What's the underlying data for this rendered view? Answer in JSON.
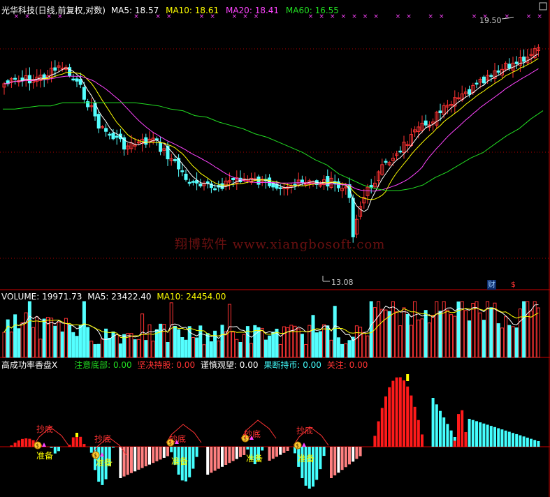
{
  "header": {
    "title": "光华科技(日线,前复权,对数)",
    "ma5_label": "MA5:",
    "ma5": "18.57",
    "ma10_label": "MA10:",
    "ma10": "18.61",
    "ma20_label": "MA20:",
    "ma20": "18.41",
    "ma60_label": "MA60:",
    "ma60": "16.55"
  },
  "annotations": {
    "high_label": "19.50",
    "low_label": "13.08",
    "cai_label": "财",
    "s_label": "$",
    "watermark": "翔博软件 www.xiangbosoft.com"
  },
  "volume_header": {
    "volume_label": "VOLUME:",
    "volume": "19971.73",
    "ma5_label": "MA5:",
    "ma5": "23422.40",
    "ma10_label": "MA10:",
    "ma10": "24454.00"
  },
  "indicator_header": {
    "name": "高成功率香盘X",
    "l1": "注意底部:",
    "v1": "0.00",
    "l2": "坚决持股:",
    "v2": "0.00",
    "l3": "谨慎观望:",
    "v3": "0.00",
    "l4": "果断持币:",
    "v4": "0.00",
    "l5": "关注:",
    "v5": "0.00"
  },
  "signals": {
    "bottom_labels": [
      "抄底",
      "抄底",
      "抄底",
      "抄底",
      "抄底"
    ],
    "ready_labels": [
      "准备",
      "准备",
      "准备",
      "准备",
      "准备"
    ],
    "coin_label": "$"
  },
  "colors": {
    "up": "#ff3333",
    "down": "#54ffff",
    "ma5": "#ffffff",
    "ma10": "#ffff00",
    "ma20": "#ff44ff",
    "ma60": "#22dd22",
    "grid": "#b00000",
    "bar_red": "#ff1a1a",
    "bar_pink": "#ff8080",
    "bar_cyan": "#44ffff",
    "bar_white": "#ffffff",
    "bar_yellow": "#ffff00"
  },
  "chart_data": {
    "type": "candlestick",
    "ma60": [
      16.6,
      16.6,
      16.65,
      16.7,
      16.7,
      16.8,
      16.8,
      16.8,
      16.8,
      16.8,
      16.8,
      16.8,
      16.75,
      16.7,
      16.6,
      16.55,
      16.4,
      16.35,
      16.2,
      16.1,
      16.0,
      15.85,
      15.75,
      15.6,
      15.45,
      15.3,
      15.1,
      14.95,
      14.7,
      14.55,
      14.4,
      14.3,
      14.25,
      14.25,
      14.3,
      14.4,
      14.6,
      14.75,
      14.95,
      15.15,
      15.3,
      15.55,
      15.8,
      16.0,
      16.3,
      16.55
    ],
    "ma20": [
      17.4,
      17.5,
      17.5,
      17.5,
      17.5,
      17.6,
      17.6,
      17.6,
      17.5,
      17.3,
      17.1,
      16.8,
      16.6,
      16.4,
      16.3,
      16.2,
      16.0,
      15.7,
      15.45,
      15.2,
      15.0,
      14.9,
      14.8,
      14.7,
      14.7,
      14.5,
      14.3,
      14.0,
      13.75,
      13.6,
      13.45,
      13.45,
      13.75,
      14.4,
      15.0,
      15.7,
      16.4,
      17.1,
      17.55,
      17.85,
      18.05,
      18.25,
      18.45,
      18.6,
      18.65,
      18.7
    ]
  }
}
